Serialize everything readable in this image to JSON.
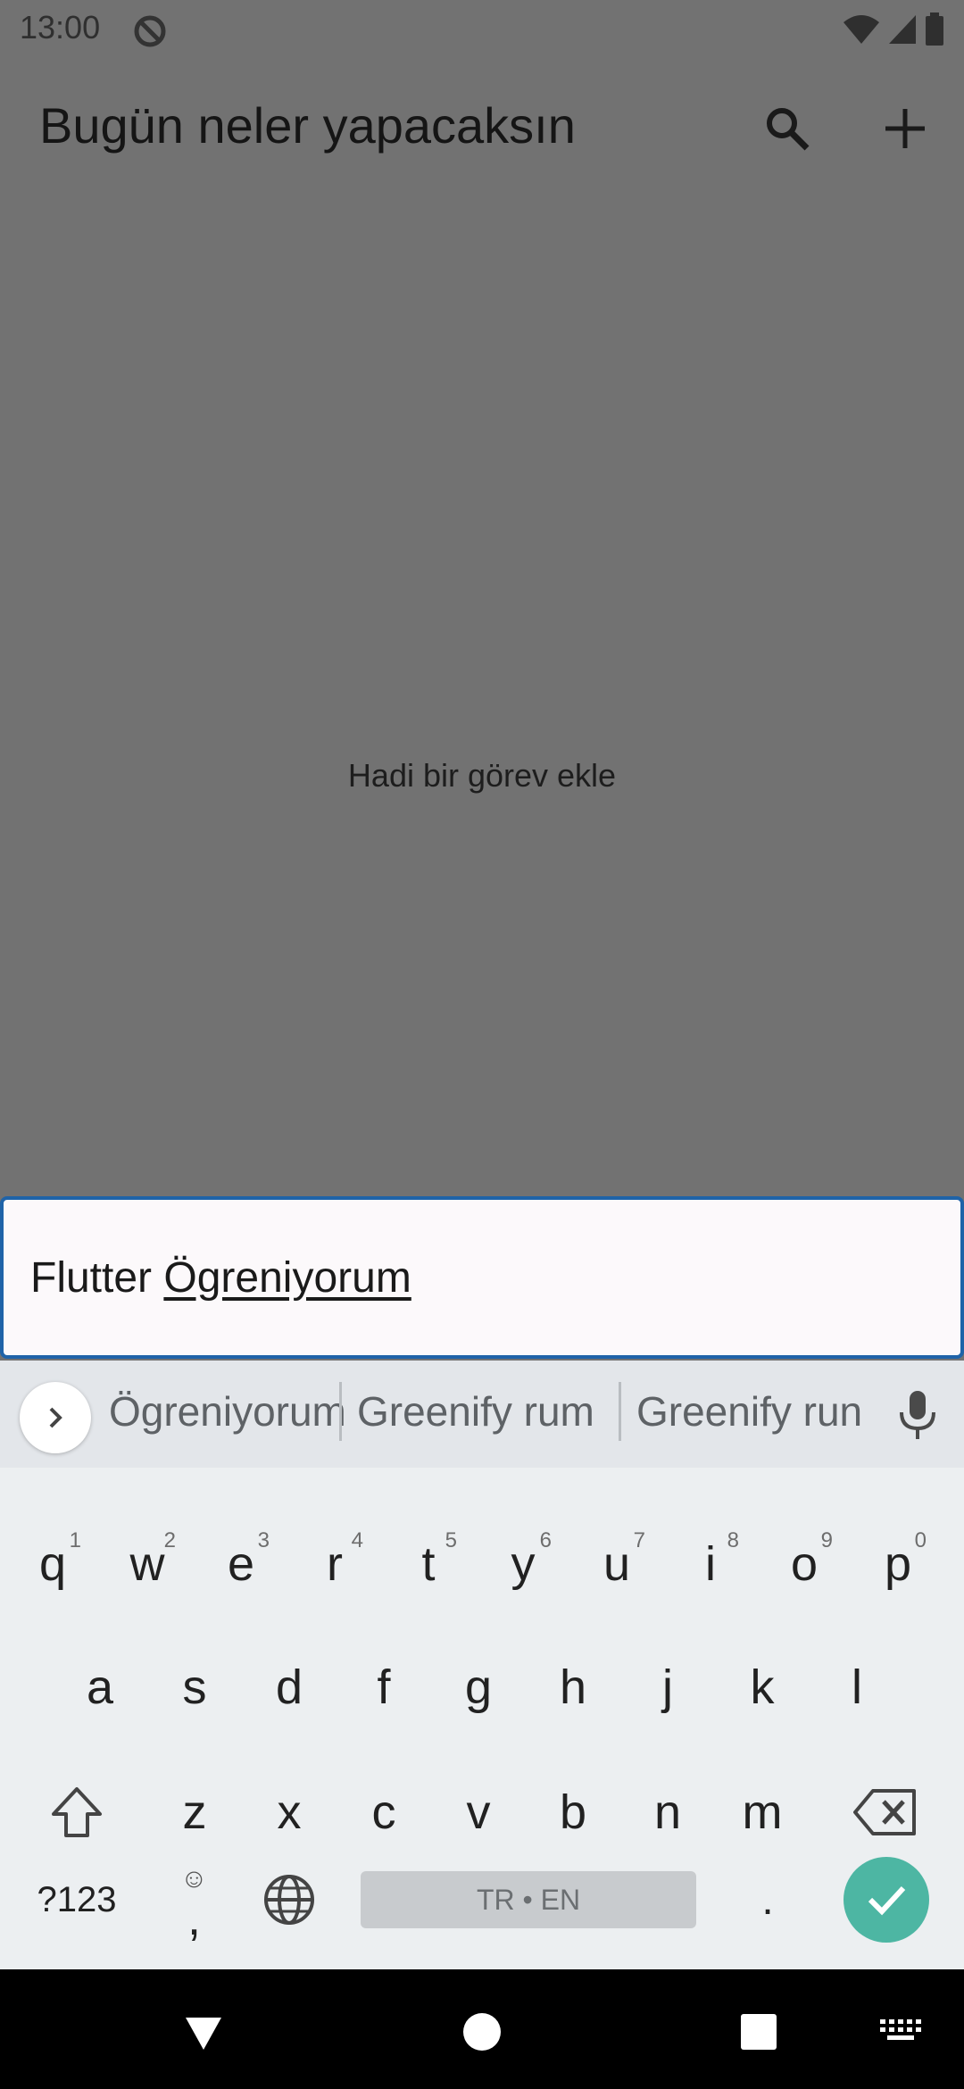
{
  "status_bar": {
    "time": "13:00"
  },
  "app_bar": {
    "title": "Bugün neler yapacaksın"
  },
  "main": {
    "empty_message": "Hadi bir görev ekle"
  },
  "input": {
    "text_prefix": "Flutter ",
    "composing_word": "Ögreniyorum"
  },
  "suggestions": [
    "Ögreniyorum",
    "Greenify rum",
    "Greenify run"
  ],
  "keyboard": {
    "row1": [
      {
        "key": "q",
        "hint": "1"
      },
      {
        "key": "w",
        "hint": "2"
      },
      {
        "key": "e",
        "hint": "3"
      },
      {
        "key": "r",
        "hint": "4"
      },
      {
        "key": "t",
        "hint": "5"
      },
      {
        "key": "y",
        "hint": "6"
      },
      {
        "key": "u",
        "hint": "7"
      },
      {
        "key": "i",
        "hint": "8"
      },
      {
        "key": "o",
        "hint": "9"
      },
      {
        "key": "p",
        "hint": "0"
      }
    ],
    "row2": [
      "a",
      "s",
      "d",
      "f",
      "g",
      "h",
      "j",
      "k",
      "l"
    ],
    "row3": [
      "z",
      "x",
      "c",
      "v",
      "b",
      "n",
      "m"
    ],
    "symbols_label": "?123",
    "comma_label": ",",
    "period_label": ".",
    "space_label": "TR • EN"
  },
  "colors": {
    "accent": "#4db6a3",
    "focus_border": "#1f63a8",
    "scrim": "#727272"
  }
}
